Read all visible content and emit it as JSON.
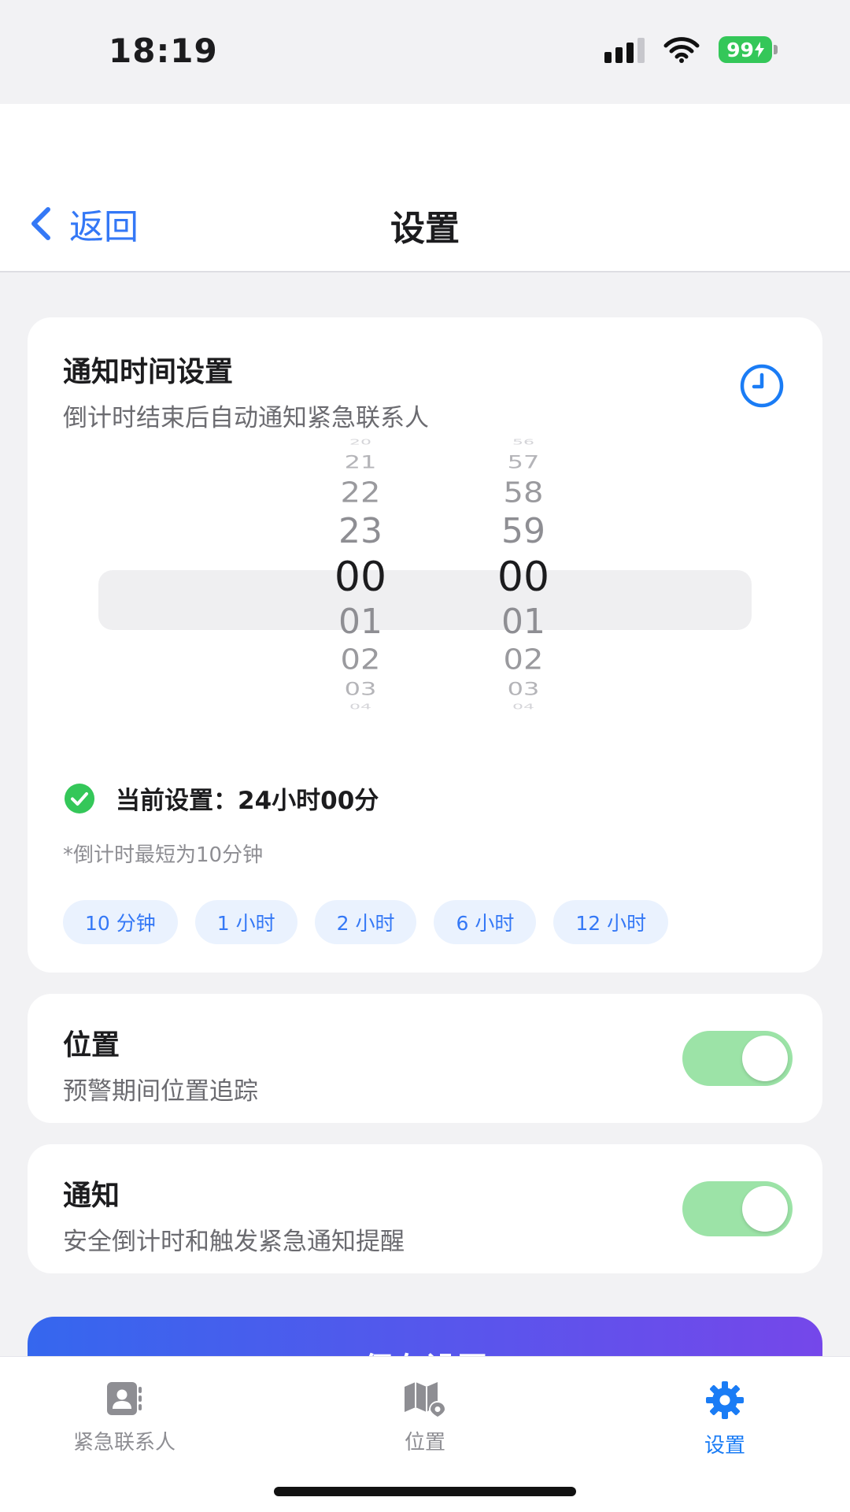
{
  "status_bar": {
    "time": "18:19",
    "battery": "99"
  },
  "nav": {
    "back_label": "返回",
    "title": "设置"
  },
  "timer_card": {
    "title": "通知时间设置",
    "subtitle": "倒计时结束后自动通知紧急联系人",
    "picker": {
      "hours": [
        "20",
        "21",
        "22",
        "23",
        "00",
        "01",
        "02",
        "03",
        "04"
      ],
      "minutes": [
        "56",
        "57",
        "58",
        "59",
        "00",
        "01",
        "02",
        "03",
        "04"
      ]
    },
    "current_label": "当前设置：",
    "current_value": "24小时00分",
    "note": "*倒计时最短为10分钟",
    "chips": [
      "10 分钟",
      "1 小时",
      "2 小时",
      "6 小时",
      "12 小时"
    ]
  },
  "location_card": {
    "title": "位置",
    "subtitle": "预警期间位置追踪",
    "enabled": true
  },
  "notify_card": {
    "title": "通知",
    "subtitle": "安全倒计时和触发紧急通知提醒",
    "enabled": true
  },
  "save_button_label": "保存设置",
  "tabs": [
    {
      "label": "紧急联系人",
      "icon": "contact-book-icon",
      "active": false
    },
    {
      "label": "位置",
      "icon": "map-pin-icon",
      "active": false
    },
    {
      "label": "设置",
      "icon": "gear-icon",
      "active": true
    }
  ],
  "colors": {
    "accent": "#3478f6",
    "success": "#34c759",
    "toggle_on": "#9ce3a7",
    "gradient_start": "#3567ee",
    "gradient_end": "#7547ea"
  }
}
